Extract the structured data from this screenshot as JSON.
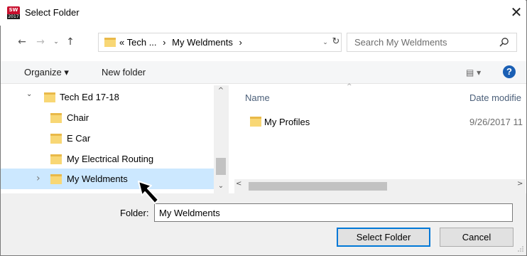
{
  "window": {
    "title": "Select Folder",
    "app_icon": "solidworks-2017-icon",
    "app_icon_text": "2017",
    "close_glyph": "✕"
  },
  "nav": {
    "back_glyph": "←",
    "forward_glyph": "→",
    "recent_glyph": "⌄",
    "up_glyph": "↑",
    "breadcrumb_prefix": "«",
    "breadcrumbs": [
      "Tech ...",
      "My Weldments"
    ],
    "separator": "›",
    "dropdown_glyph": "⌄",
    "refresh_glyph": "↻"
  },
  "search": {
    "placeholder": "Search My Weldments",
    "icon": "search-icon"
  },
  "toolbar": {
    "organize_label": "Organize ▾",
    "new_folder_label": "New folder",
    "view_label": "▤ ▾",
    "help_label": "?"
  },
  "tree": {
    "items": [
      {
        "label": "Tech Ed 17-18",
        "expanded": true
      },
      {
        "label": "Chair"
      },
      {
        "label": "E Car"
      },
      {
        "label": "My Electrical Routing"
      },
      {
        "label": "My Weldments",
        "selected": true
      }
    ],
    "expanded_glyph": "⌄",
    "collapsed_glyph": "›"
  },
  "list": {
    "columns": [
      "Name",
      "Date modifie"
    ],
    "sort_glyph": "^",
    "rows": [
      {
        "name": "My Profiles",
        "date": "9/26/2017 11"
      }
    ]
  },
  "scroll": {
    "up_glyph": "^",
    "down_glyph": "⌄",
    "left_glyph": "<",
    "right_glyph": ">"
  },
  "footer": {
    "folder_label": "Folder:",
    "folder_value": "My Weldments",
    "select_label": "Select Folder",
    "cancel_label": "Cancel"
  },
  "colors": {
    "selection": "#cce8ff",
    "accent": "#0078d7",
    "folder": "#f8d775"
  }
}
